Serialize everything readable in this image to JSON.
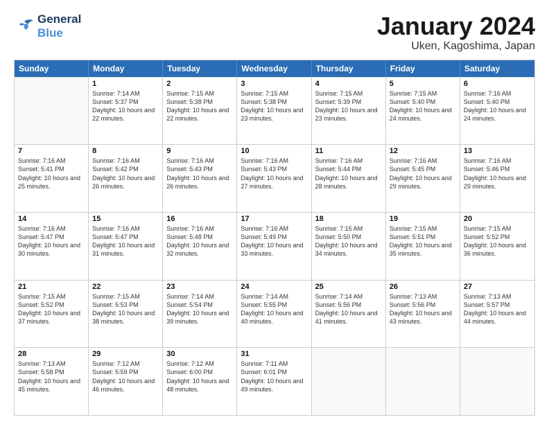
{
  "header": {
    "logo_line1": "General",
    "logo_line2": "Blue",
    "month": "January 2024",
    "location": "Uken, Kagoshima, Japan"
  },
  "days_of_week": [
    "Sunday",
    "Monday",
    "Tuesday",
    "Wednesday",
    "Thursday",
    "Friday",
    "Saturday"
  ],
  "weeks": [
    [
      {
        "day": "",
        "content": ""
      },
      {
        "day": "1",
        "content": "Sunrise: 7:14 AM\nSunset: 5:37 PM\nDaylight: 10 hours\nand 22 minutes."
      },
      {
        "day": "2",
        "content": "Sunrise: 7:15 AM\nSunset: 5:38 PM\nDaylight: 10 hours\nand 22 minutes."
      },
      {
        "day": "3",
        "content": "Sunrise: 7:15 AM\nSunset: 5:38 PM\nDaylight: 10 hours\nand 23 minutes."
      },
      {
        "day": "4",
        "content": "Sunrise: 7:15 AM\nSunset: 5:39 PM\nDaylight: 10 hours\nand 23 minutes."
      },
      {
        "day": "5",
        "content": "Sunrise: 7:15 AM\nSunset: 5:40 PM\nDaylight: 10 hours\nand 24 minutes."
      },
      {
        "day": "6",
        "content": "Sunrise: 7:16 AM\nSunset: 5:40 PM\nDaylight: 10 hours\nand 24 minutes."
      }
    ],
    [
      {
        "day": "7",
        "content": "Sunrise: 7:16 AM\nSunset: 5:41 PM\nDaylight: 10 hours\nand 25 minutes."
      },
      {
        "day": "8",
        "content": "Sunrise: 7:16 AM\nSunset: 5:42 PM\nDaylight: 10 hours\nand 26 minutes."
      },
      {
        "day": "9",
        "content": "Sunrise: 7:16 AM\nSunset: 5:43 PM\nDaylight: 10 hours\nand 26 minutes."
      },
      {
        "day": "10",
        "content": "Sunrise: 7:16 AM\nSunset: 5:43 PM\nDaylight: 10 hours\nand 27 minutes."
      },
      {
        "day": "11",
        "content": "Sunrise: 7:16 AM\nSunset: 5:44 PM\nDaylight: 10 hours\nand 28 minutes."
      },
      {
        "day": "12",
        "content": "Sunrise: 7:16 AM\nSunset: 5:45 PM\nDaylight: 10 hours\nand 29 minutes."
      },
      {
        "day": "13",
        "content": "Sunrise: 7:16 AM\nSunset: 5:46 PM\nDaylight: 10 hours\nand 29 minutes."
      }
    ],
    [
      {
        "day": "14",
        "content": "Sunrise: 7:16 AM\nSunset: 5:47 PM\nDaylight: 10 hours\nand 30 minutes."
      },
      {
        "day": "15",
        "content": "Sunrise: 7:16 AM\nSunset: 5:47 PM\nDaylight: 10 hours\nand 31 minutes."
      },
      {
        "day": "16",
        "content": "Sunrise: 7:16 AM\nSunset: 5:48 PM\nDaylight: 10 hours\nand 32 minutes."
      },
      {
        "day": "17",
        "content": "Sunrise: 7:16 AM\nSunset: 5:49 PM\nDaylight: 10 hours\nand 33 minutes."
      },
      {
        "day": "18",
        "content": "Sunrise: 7:15 AM\nSunset: 5:50 PM\nDaylight: 10 hours\nand 34 minutes."
      },
      {
        "day": "19",
        "content": "Sunrise: 7:15 AM\nSunset: 5:51 PM\nDaylight: 10 hours\nand 35 minutes."
      },
      {
        "day": "20",
        "content": "Sunrise: 7:15 AM\nSunset: 5:52 PM\nDaylight: 10 hours\nand 36 minutes."
      }
    ],
    [
      {
        "day": "21",
        "content": "Sunrise: 7:15 AM\nSunset: 5:52 PM\nDaylight: 10 hours\nand 37 minutes."
      },
      {
        "day": "22",
        "content": "Sunrise: 7:15 AM\nSunset: 5:53 PM\nDaylight: 10 hours\nand 38 minutes."
      },
      {
        "day": "23",
        "content": "Sunrise: 7:14 AM\nSunset: 5:54 PM\nDaylight: 10 hours\nand 39 minutes."
      },
      {
        "day": "24",
        "content": "Sunrise: 7:14 AM\nSunset: 5:55 PM\nDaylight: 10 hours\nand 40 minutes."
      },
      {
        "day": "25",
        "content": "Sunrise: 7:14 AM\nSunset: 5:56 PM\nDaylight: 10 hours\nand 41 minutes."
      },
      {
        "day": "26",
        "content": "Sunrise: 7:13 AM\nSunset: 5:56 PM\nDaylight: 10 hours\nand 43 minutes."
      },
      {
        "day": "27",
        "content": "Sunrise: 7:13 AM\nSunset: 5:57 PM\nDaylight: 10 hours\nand 44 minutes."
      }
    ],
    [
      {
        "day": "28",
        "content": "Sunrise: 7:13 AM\nSunset: 5:58 PM\nDaylight: 10 hours\nand 45 minutes."
      },
      {
        "day": "29",
        "content": "Sunrise: 7:12 AM\nSunset: 5:59 PM\nDaylight: 10 hours\nand 46 minutes."
      },
      {
        "day": "30",
        "content": "Sunrise: 7:12 AM\nSunset: 6:00 PM\nDaylight: 10 hours\nand 48 minutes."
      },
      {
        "day": "31",
        "content": "Sunrise: 7:11 AM\nSunset: 6:01 PM\nDaylight: 10 hours\nand 49 minutes."
      },
      {
        "day": "",
        "content": ""
      },
      {
        "day": "",
        "content": ""
      },
      {
        "day": "",
        "content": ""
      }
    ]
  ]
}
